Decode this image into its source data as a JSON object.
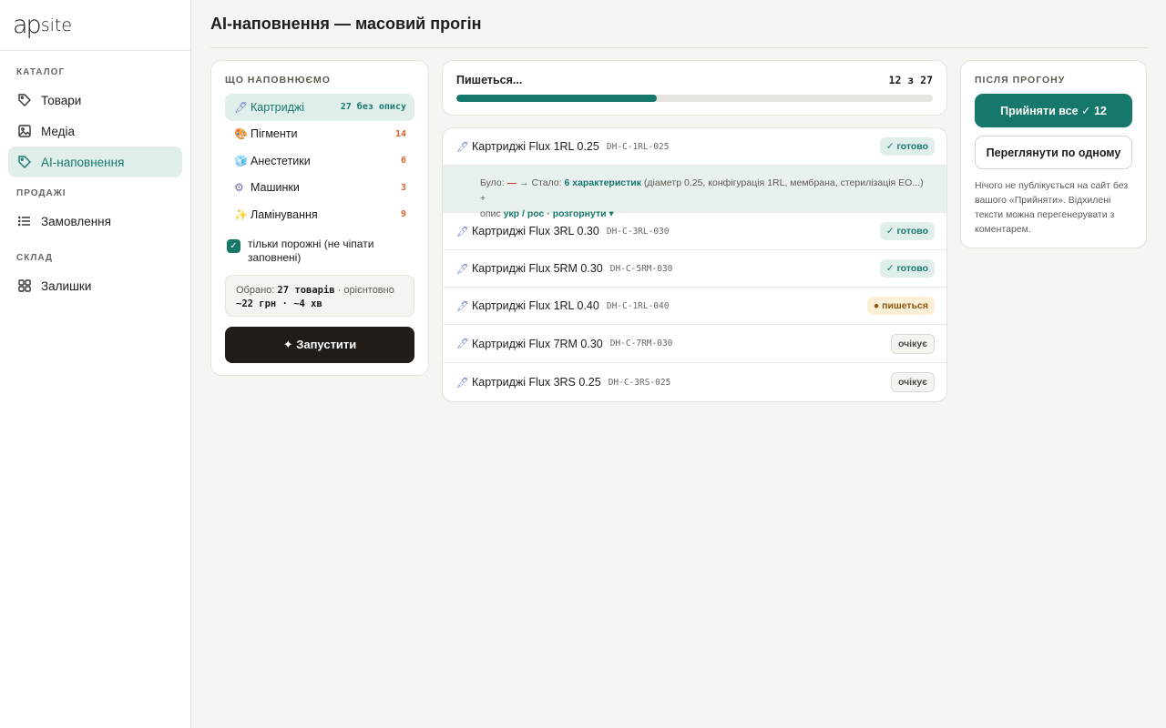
{
  "brand": {
    "logo_ap": "ap",
    "logo_site": "site"
  },
  "sidebar": {
    "sections": [
      {
        "label": "Каталог",
        "items": [
          {
            "label": "Товари",
            "icon": "tag-icon",
            "active": false
          },
          {
            "label": "Медіа",
            "icon": "image-icon",
            "active": false
          },
          {
            "label": "AI-наповнення",
            "icon": "tag-icon",
            "active": true
          }
        ]
      },
      {
        "label": "Продажі",
        "items": [
          {
            "label": "Замовлення",
            "icon": "list-icon",
            "active": false
          }
        ]
      },
      {
        "label": "Склад",
        "items": [
          {
            "label": "Залишки",
            "icon": "grid-icon",
            "active": false
          }
        ]
      }
    ]
  },
  "page": {
    "title": "AI-наповнення — масовий прогін"
  },
  "fill": {
    "label": "Що наповнюємо",
    "categories": [
      {
        "emoji": "🖊",
        "name": "Картриджі",
        "count": "27 без опису",
        "active": true
      },
      {
        "emoji": "🎨",
        "name": "Пігменти",
        "count": "14",
        "active": false
      },
      {
        "emoji": "🧊",
        "name": "Анестетики",
        "count": "6",
        "active": false
      },
      {
        "emoji": "⚙",
        "name": "Машинки",
        "count": "3",
        "active": false
      },
      {
        "emoji": "✨",
        "name": "Ламінування",
        "count": "9",
        "active": false
      }
    ],
    "only_empty_label": "тільки порожні (не чіпати заповнені)",
    "only_empty_checked": true,
    "summary": {
      "prefix": "Обрано:",
      "goods": "27 товарів",
      "middle": "· орієнтовно",
      "cost": "~22 грн · ~4 хв"
    },
    "run_label": "✦ Запустити"
  },
  "progress": {
    "label": "Пишеться...",
    "done": 12,
    "total": 27,
    "count_text": "12 з 27",
    "fraction": 0.42
  },
  "items": [
    {
      "name": "Картриджі Flux 1RL 0.25",
      "sku": "DH-C-1RL-025",
      "status": "done",
      "status_label": "✓ готово",
      "expanded": true
    },
    {
      "name": "Картриджі Flux 3RL 0.30",
      "sku": "DH-C-3RL-030",
      "status": "done",
      "status_label": "✓ готово"
    },
    {
      "name": "Картриджі Flux 5RM 0.30",
      "sku": "DH-C-5RM-030",
      "status": "done",
      "status_label": "✓ готово"
    },
    {
      "name": "Картриджі Flux 1RL 0.40",
      "sku": "DH-C-1RL-040",
      "status": "writing",
      "status_label": "● пишеться"
    },
    {
      "name": "Картриджі Flux 7RM 0.30",
      "sku": "DH-C-7RM-030",
      "status": "wait",
      "status_label": "очікує"
    },
    {
      "name": "Картриджі Flux 3RS 0.25",
      "sku": "DH-C-3RS-025",
      "status": "wait",
      "status_label": "очікує"
    }
  ],
  "detail": {
    "was": "Було:",
    "dash": "—",
    "arrow": "→ Стало:",
    "features": "6 характеристик",
    "features_desc": "(діаметр 0.25, конфігурація 1RL, мембрана, стерилізація EO...) +",
    "desc_label": "опис",
    "langs": "укр / рос",
    "sep": "·",
    "expand": "розгорнути ▾"
  },
  "after": {
    "label": "Після прогону",
    "accept_label": "Прийняти все ✓ 12",
    "review_label": "Переглянути по одному",
    "note": "Нічого не публікується на сайт без вашого «Прийняти». Відхилені тексти можна перегенерувати з коментарем."
  },
  "colors": {
    "accent": "#16786b",
    "accent_bg": "#e1efec",
    "dark": "#221c18",
    "warn": "#d9622b"
  }
}
